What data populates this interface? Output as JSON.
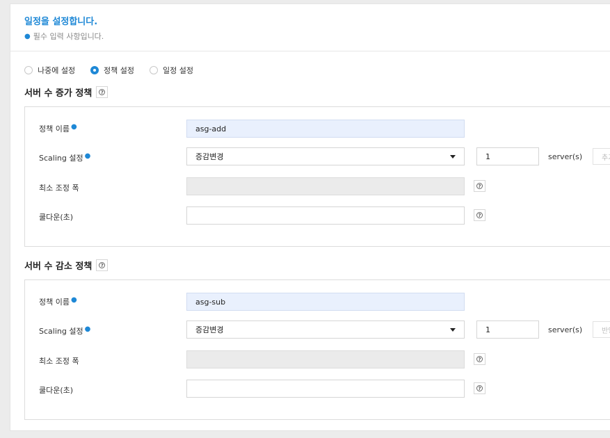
{
  "header": {
    "title": "일정을 설정합니다.",
    "required_note": "필수 입력 사항입니다."
  },
  "schedule_options": [
    {
      "label": "나중에 설정",
      "checked": false
    },
    {
      "label": "정책 설정",
      "checked": true
    },
    {
      "label": "일정 설정",
      "checked": false
    }
  ],
  "help_glyph": "?",
  "unit_label": "server(s)",
  "scale_out": {
    "title": "서버 수 증가 정책",
    "name_label": "정책 이름",
    "name_value": "asg-add",
    "scaling_label": "Scaling 설정",
    "scaling_select": "증감변경",
    "scaling_count": "1",
    "action_button": "추가",
    "min_adjust_label": "최소 조정 폭",
    "min_adjust_value": "",
    "cooldown_label": "쿨다운(초)",
    "cooldown_value": ""
  },
  "scale_in": {
    "title": "서버 수 감소 정책",
    "name_label": "정책 이름",
    "name_value": "asg-sub",
    "scaling_label": "Scaling 설정",
    "scaling_select": "증감변경",
    "scaling_count": "1",
    "action_button": "반영",
    "min_adjust_label": "최소 조정 폭",
    "min_adjust_value": "",
    "cooldown_label": "쿨다운(초)",
    "cooldown_value": ""
  },
  "colors": {
    "accent": "#1e88d6",
    "background": "#ececec",
    "filled_input": "#e9f0fd",
    "disabled_input": "#ebebeb"
  }
}
